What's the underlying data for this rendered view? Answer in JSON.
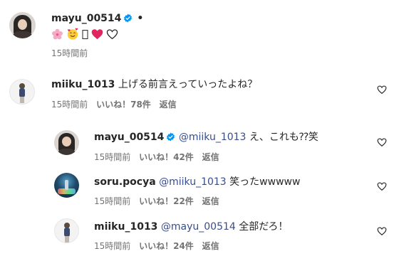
{
  "post": {
    "username": "mayu_00514",
    "dot": "•",
    "emojis": [
      "sakura-flower",
      "smiling-face-with-hearts",
      "missing-glyph",
      "red-heart",
      "white-heart"
    ],
    "time": "15時間前"
  },
  "comments": [
    {
      "username": "miiku_1013",
      "text": "上げる前言えっていったよね？",
      "time": "15時間前",
      "likes": "いいね！78件",
      "reply_label": "返信"
    },
    {
      "username": "mayu_00514",
      "mention": "@miiku_1013",
      "text": "え、これも⁇笑",
      "time": "15時間前",
      "likes": "いいね！42件",
      "reply_label": "返信"
    },
    {
      "username": "soru.pocya",
      "mention": "@miiku_1013",
      "text": "笑ったwwwww",
      "time": "15時間前",
      "likes": "いいね！22件",
      "reply_label": "返信"
    },
    {
      "username": "miiku_1013",
      "mention": "@mayu_00514",
      "text": "全部だろ！",
      "time": "15時間前",
      "likes": "いいね！24件",
      "reply_label": "返信"
    }
  ],
  "colors": {
    "verified": "#0095f6",
    "mention": "#384d8c",
    "meta": "#737373",
    "heart_red": "#e0245e"
  }
}
